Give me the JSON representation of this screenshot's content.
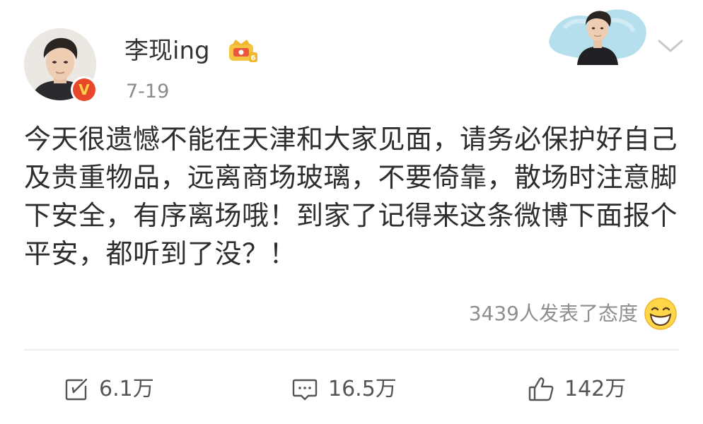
{
  "post": {
    "username": "李现ing",
    "date": "7-19",
    "text": "今天很遗憾不能在天津和大家见面，请务必保护好自己及贵重物品，远离商场玻璃，不要倚靠，散场时注意脚下安全，有序离场哦！到家了记得来这条微博下面报个平安，都听到了没？！",
    "reactions_text": "3439人发表了态度",
    "verified_badge_text": "V"
  },
  "actions": {
    "repost_count": "6.1万",
    "comment_count": "16.5万",
    "like_count": "142万"
  },
  "icons": {
    "verified": "verified-v-icon",
    "vip": "crown-vip-icon",
    "chevron": "chevron-down-icon",
    "emoji": "grinning-emoji-icon",
    "repost": "repost-icon",
    "comment": "comment-icon",
    "like": "thumbs-up-icon"
  },
  "colors": {
    "verified_bg": "#e8472a",
    "vip_gold": "#f2b731",
    "text": "#2e2e2e",
    "muted": "#8e8e8e"
  }
}
